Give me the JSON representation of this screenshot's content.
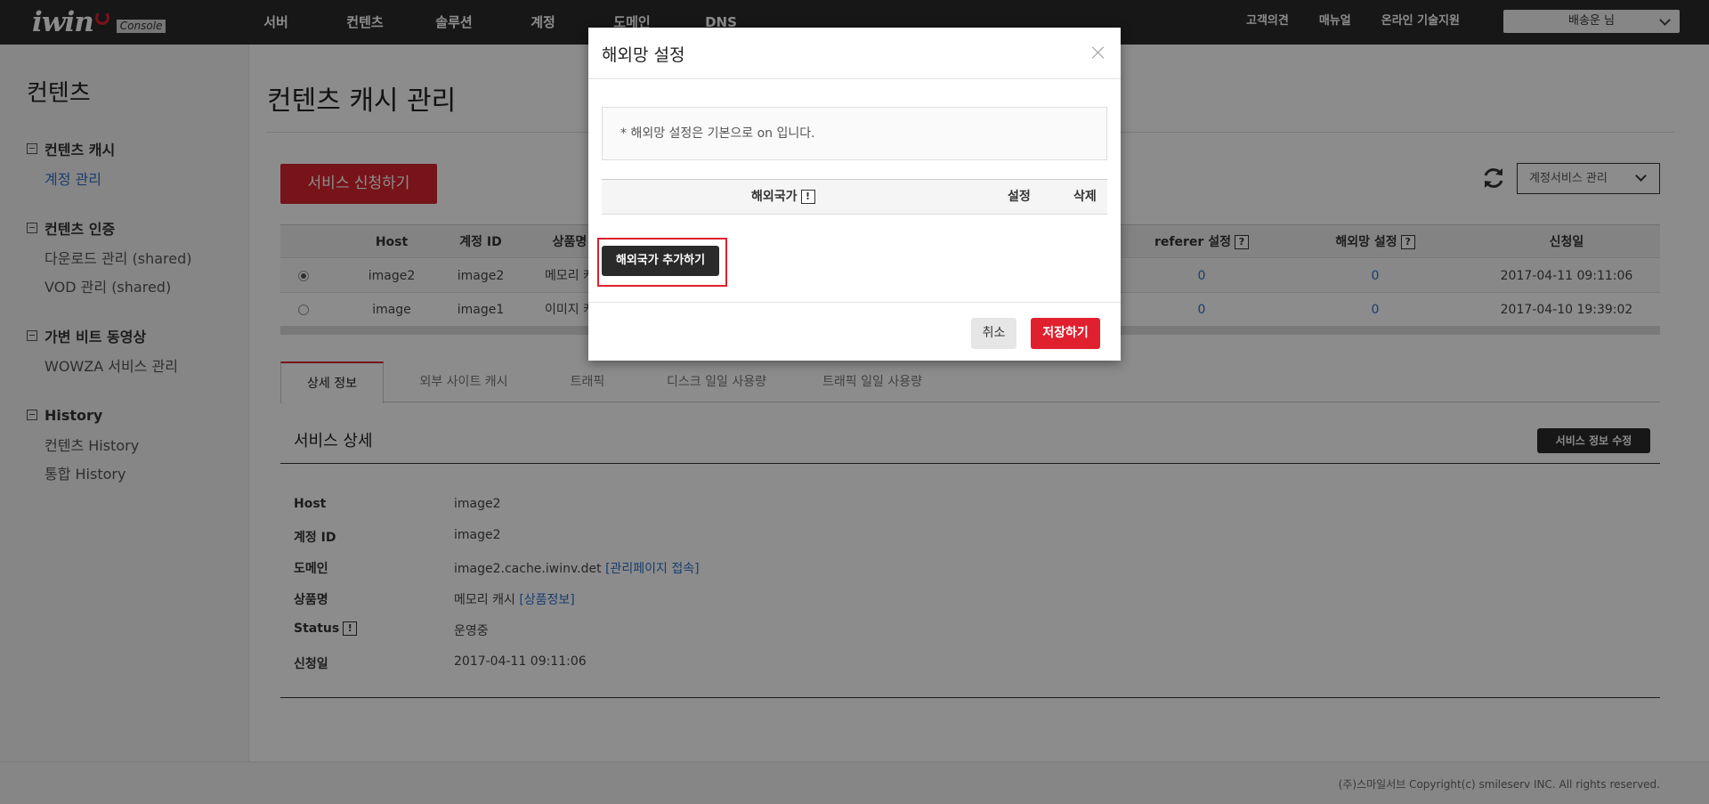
{
  "brand": {
    "logo": "iwin",
    "badge": "Console",
    "accent": "#d9252f"
  },
  "nav": {
    "items": [
      "서버",
      "컨텐츠",
      "솔루션",
      "계정",
      "도메인",
      "DNS"
    ],
    "right": [
      "고객의견",
      "매뉴얼",
      "온라인 기술지원"
    ],
    "user": "배송운 님"
  },
  "sidebar": {
    "title": "컨텐츠",
    "groups": [
      {
        "label": "컨텐츠 캐시",
        "items": [
          "계정 관리"
        ]
      },
      {
        "label": "컨텐츠 인증",
        "items": [
          "다운로드 관리 (shared)",
          "VOD 관리 (shared)"
        ]
      },
      {
        "label": "가변 비트 동영상",
        "items": [
          "WOWZA 서비스 관리"
        ]
      },
      {
        "label": "History",
        "items": [
          "컨텐츠 History",
          "통합 History"
        ]
      }
    ]
  },
  "main": {
    "title": "컨텐츠 캐시 관리",
    "apply_button": "서비스 신청하기",
    "select": "계정서비스 관리",
    "table": {
      "headers": {
        "host": "Host",
        "account": "계정 ID",
        "product": "상품명",
        "referer": "referer 설정",
        "overseas": "해외망 설정",
        "date": "신청일"
      },
      "rows": [
        {
          "host": "image2",
          "account": "image2",
          "product": "메모리 캐",
          "referer": "0",
          "overseas": "0",
          "date": "2017-04-11 09:11:06",
          "selected": true
        },
        {
          "host": "image",
          "account": "image1",
          "product": "이미지 캐",
          "referer": "0",
          "overseas": "0",
          "date": "2017-04-10 19:39:02",
          "selected": false
        }
      ]
    },
    "tabs": [
      "상세 정보",
      "외부 사이트 캐시",
      "트래픽",
      "디스크 일일 사용량",
      "트래픽 일일 사용량"
    ],
    "detail": {
      "title": "서비스 상세",
      "edit_button": "서비스 정보 수정",
      "fields": [
        {
          "label": "Host",
          "value": "image2"
        },
        {
          "label": "계정 ID",
          "value": "image2"
        },
        {
          "label": "도메인",
          "value": "image2.cache.iwinv.det",
          "link": "[관리페이지 접속]"
        },
        {
          "label": "상품명",
          "value": "메모리 캐시",
          "link": "[상품정보]"
        },
        {
          "label": "Status",
          "value": "운영중"
        },
        {
          "label": "신청일",
          "value": "2017-04-11 09:11:06"
        }
      ]
    }
  },
  "footer": "(주)스마일서브 Copyright(c) smileserv INC. All rights reserved.",
  "modal": {
    "title": "해외망 설정",
    "notice": "* 해외망 설정은 기본으로 on 입니다.",
    "headers": {
      "country": "해외국가",
      "setting": "설정",
      "delete": "삭제"
    },
    "add_button": "해외국가 추가하기",
    "cancel": "취소",
    "save": "저장하기"
  },
  "icons": {
    "info": "!",
    "help": "?"
  }
}
